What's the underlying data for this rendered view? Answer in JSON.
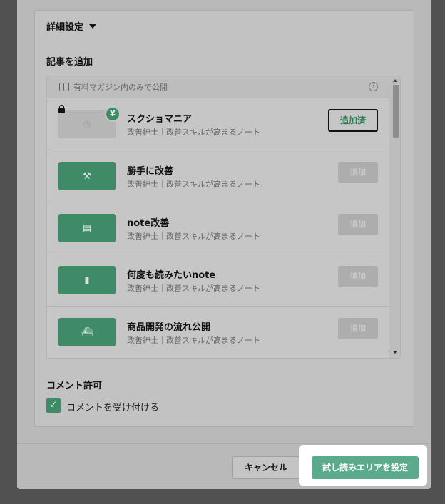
{
  "modal": {
    "detail_settings_label": "詳細設定",
    "add_articles_title": "記事を追加",
    "list_header": "有料マガジン内のみで公開",
    "articles": [
      {
        "title": "スクショマニア",
        "subtitle": "改善紳士｜改善スキルが高まるノート",
        "button": "追加済",
        "icon": "clock-icon",
        "thumb_symbol": "◷"
      },
      {
        "title": "勝手に改善",
        "subtitle": "改善紳士｜改善スキルが高まるノート",
        "button": "追加",
        "icon": "hammer-icon",
        "thumb_symbol": "⚒"
      },
      {
        "title": "note改善",
        "subtitle": "改善紳士｜改善スキルが高まるノート",
        "button": "追加",
        "icon": "document-icon",
        "thumb_symbol": "▤"
      },
      {
        "title": "何度も読みたいnote",
        "subtitle": "改善紳士｜改善スキルが高まるノート",
        "button": "追加",
        "icon": "bookmark-icon",
        "thumb_symbol": "▮"
      },
      {
        "title": "商品開発の流れ公開",
        "subtitle": "改善紳士｜改善スキルが高まるノート",
        "button": "追加",
        "icon": "ship-icon",
        "thumb_symbol": "⛴"
      }
    ],
    "yen_symbol": "¥",
    "help_symbol": "?",
    "comment_title": "コメント許可",
    "comment_checkbox_label": "コメントを受け付ける",
    "comment_checked": true,
    "check_symbol": "✓"
  },
  "footer": {
    "cancel_label": "キャンセル",
    "primary_label": "試し読みエリアを設定"
  },
  "colors": {
    "accent": "#3f8b68",
    "primary_button": "#5aaa8b",
    "overlay": "#515151"
  }
}
